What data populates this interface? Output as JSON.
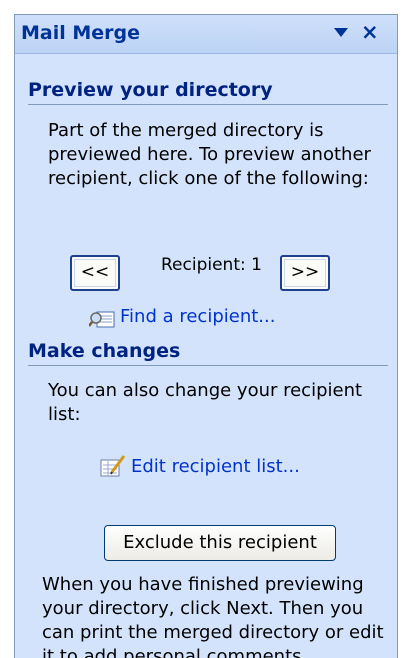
{
  "pane": {
    "title": "Mail Merge",
    "dropdown_icon": "triangle-down",
    "close_label": "×"
  },
  "preview": {
    "heading": "Preview your directory",
    "description": "Part of the merged directory is previewed here. To preview another recipient, click one of the following:",
    "prev_label": "<<",
    "recipient_label": "Recipient: 1",
    "next_label": ">>",
    "find_link": "Find a recipient..."
  },
  "changes": {
    "heading": "Make changes",
    "description": "You can also change your recipient list:",
    "edit_link": "Edit recipient list...",
    "exclude_label": "Exclude this recipient",
    "footer_text": "When you have finished previewing your directory, click Next. Then you can print the merged directory or edit it to add personal comments."
  },
  "colors": {
    "pane_bg": "#d4e3fc",
    "heading": "#002280",
    "link": "#0033cc",
    "title": "#003399"
  }
}
